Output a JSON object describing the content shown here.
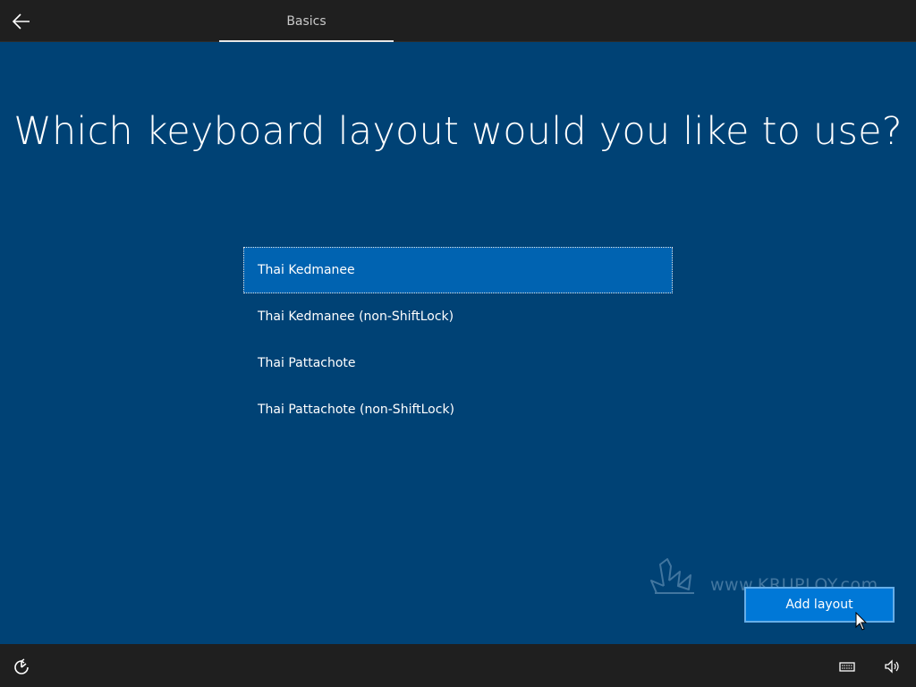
{
  "header": {
    "tab_label": "Basics",
    "back_icon": "back-arrow-icon"
  },
  "main": {
    "heading": "Which keyboard layout would you like to use?",
    "layouts": [
      {
        "label": "Thai Kedmanee",
        "selected": true
      },
      {
        "label": "Thai Kedmanee (non-ShiftLock)",
        "selected": false
      },
      {
        "label": "Thai Pattachote",
        "selected": false
      },
      {
        "label": "Thai Pattachote (non-ShiftLock)",
        "selected": false
      }
    ],
    "add_button_label": "Add layout"
  },
  "watermark": {
    "text": "www.KRUPLOY.com"
  },
  "footer": {
    "icons": [
      "ease-of-access-icon",
      "keyboard-icon",
      "volume-icon"
    ]
  },
  "colors": {
    "background": "#004275",
    "bar": "#1f1f1f",
    "selected": "#0063b1",
    "button": "#0078d7"
  }
}
